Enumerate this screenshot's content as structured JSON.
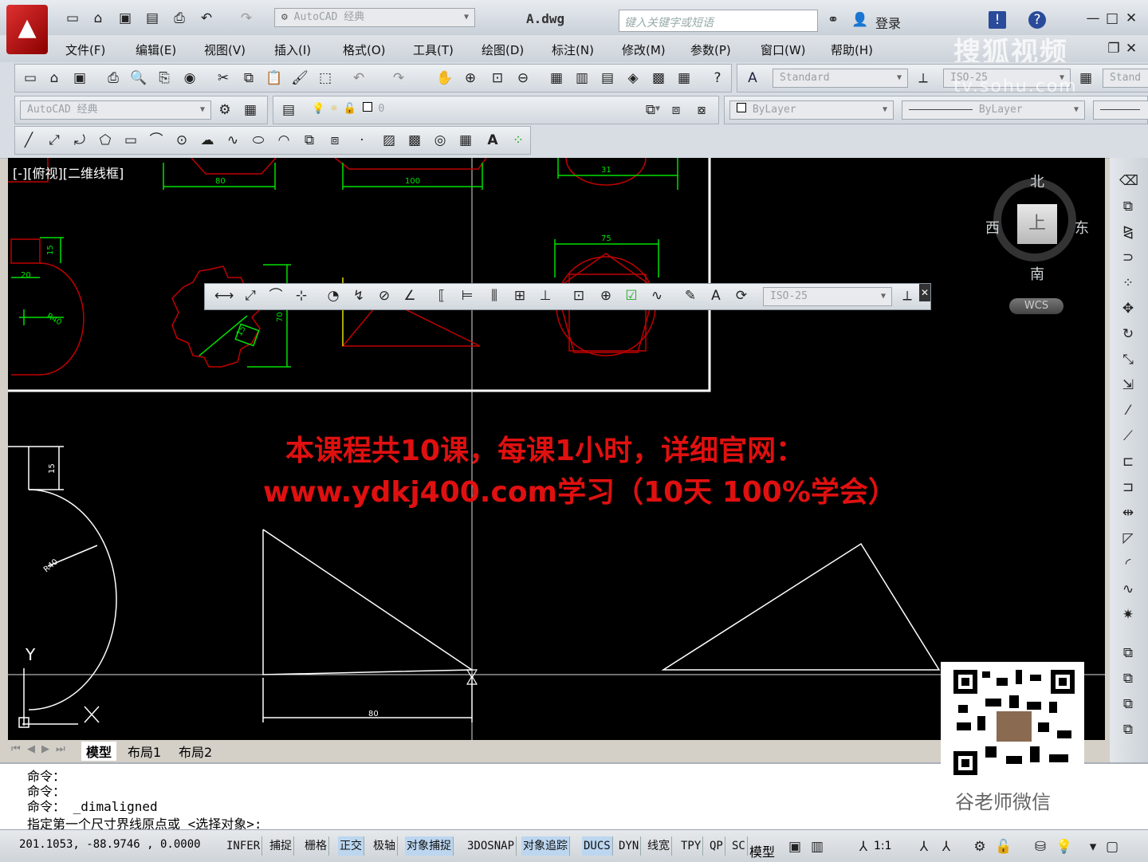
{
  "title": {
    "workspace_name": "AutoCAD 经典",
    "file_name": "A.dwg",
    "search_placeholder": "键入关键字或短语",
    "login": "登录"
  },
  "menu": [
    "文件(F)",
    "编辑(E)",
    "视图(V)",
    "插入(I)",
    "格式(O)",
    "工具(T)",
    "绘图(D)",
    "标注(N)",
    "修改(M)",
    "参数(P)",
    "窗口(W)",
    "帮助(H)"
  ],
  "watermark": {
    "brand": "搜狐视频",
    "url": "tv.sohu.com"
  },
  "toolbars": {
    "text_style": "Standard",
    "dim_style": "ISO-25",
    "table_style": "Stand",
    "workspace_combo": "AutoCAD 经典",
    "layer_value": "0",
    "color_value": "ByLayer",
    "linetype_value": "ByLayer",
    "dim_overlay_style": "ISO-25"
  },
  "viewport": {
    "label": "[-][俯视][二维线框]",
    "compass": {
      "north": "北",
      "south": "南",
      "east": "东",
      "west": "西",
      "top": "上"
    },
    "wcs": "WCS",
    "ucs_y": "Y"
  },
  "drawing_dims": [
    "80",
    "100",
    "31",
    "15",
    "20",
    "R40",
    "75",
    "70",
    "15",
    "80",
    "R40"
  ],
  "promo": {
    "line1": "本课程共10课，每课1小时，详细官网：",
    "line2": "www.ydkj400.com学习（10天 100%学会）"
  },
  "qr_caption": "谷老师微信",
  "tabs": [
    "模型",
    "布局1",
    "布局2"
  ],
  "command_history": [
    "命令：",
    "命令：",
    "命令：  _dimaligned"
  ],
  "command_prompt": "指定第一个尺寸界线原点或 <选择对象>:",
  "status": {
    "coords": "201.1053,  -88.9746 ,  0.0000",
    "toggles": [
      {
        "label": "INFER",
        "on": false
      },
      {
        "label": "捕捉",
        "on": false
      },
      {
        "label": "栅格",
        "on": false
      },
      {
        "label": "正交",
        "on": true
      },
      {
        "label": "极轴",
        "on": false
      },
      {
        "label": "对象捕捉",
        "on": true
      },
      {
        "label": "3DOSNAP",
        "on": false
      },
      {
        "label": "对象追踪",
        "on": true
      },
      {
        "label": "DUCS",
        "on": true
      },
      {
        "label": "DYN",
        "on": false
      },
      {
        "label": "线宽",
        "on": false
      },
      {
        "label": "TPY",
        "on": false
      },
      {
        "label": "QP",
        "on": false
      },
      {
        "label": "SC",
        "on": false
      }
    ],
    "model": "模型",
    "scale": "1:1"
  },
  "colors": {
    "accent_red": "#e01010",
    "canvas": "#000000",
    "dim_green": "#00e000",
    "geom_red": "#c00000"
  }
}
